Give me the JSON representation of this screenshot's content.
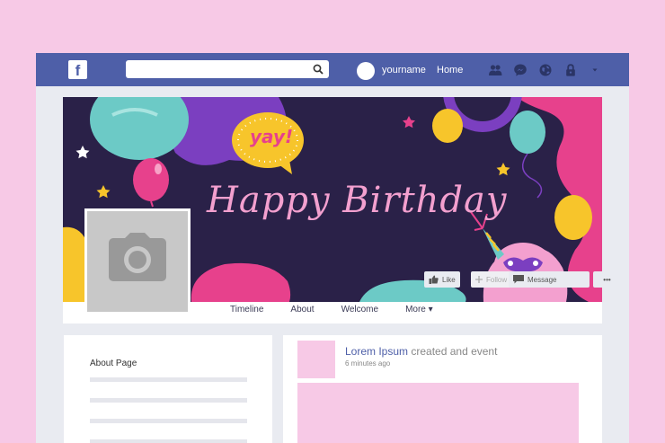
{
  "topbar": {
    "logo_letter": "f",
    "search_placeholder": "",
    "username": "yourname",
    "home_label": "Home",
    "icons": [
      "friends-icon",
      "messenger-icon",
      "globe-icon",
      "lock-icon",
      "chevron-down-icon"
    ],
    "color": "#4e5fa8"
  },
  "cover": {
    "bubble_text": "yay!",
    "title": "Happy Birthday",
    "background": "#2a2148"
  },
  "actions": {
    "like": "Like",
    "follow": "Follow",
    "message": "Message",
    "more": "•••"
  },
  "nav": {
    "tabs": [
      "Timeline",
      "About",
      "Welcome",
      "More ▾"
    ]
  },
  "about": {
    "title": "About Page"
  },
  "post": {
    "author": "Lorem Ipsum",
    "action": " created and event",
    "time": "6 minutes ago"
  },
  "colors": {
    "page_background": "#f7c9e6",
    "accent": "#4e5fa8",
    "pink": "#f7c9e6"
  }
}
